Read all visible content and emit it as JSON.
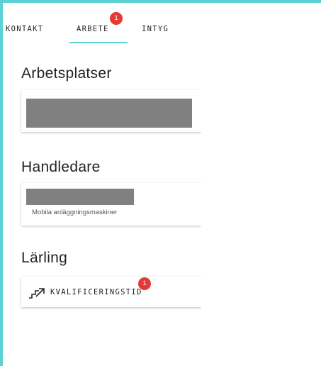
{
  "tabs": {
    "kontakt": "KONTAKT",
    "arbete": "ARBETE",
    "arbete_badge": "1",
    "intyg": "INTYG"
  },
  "sections": {
    "arbetsplatser_title": "Arbetsplatser",
    "handledare_title": "Handledare",
    "handledare_subtitle": "Mobila anläggningsmaskiner",
    "larling_title": "Lärling",
    "kvalificeringstid_label": "KVALIFICERINGSTID",
    "kvalificeringstid_badge": "1"
  },
  "colors": {
    "accent": "#5cd1d3",
    "badge": "#e53935",
    "redacted": "#808080"
  },
  "icons": {
    "kvalificeringstid": "stairs-arrow-icon"
  }
}
